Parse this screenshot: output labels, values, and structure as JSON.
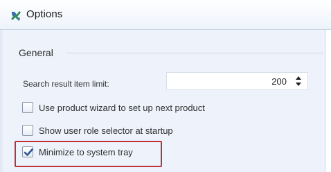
{
  "window": {
    "title": "Options"
  },
  "group": {
    "title": "General"
  },
  "search_limit": {
    "label": "Search result item limit:",
    "value": "200"
  },
  "checkboxes": [
    {
      "label": "Use product wizard to set up next product",
      "checked": false
    },
    {
      "label": "Show user role selector at startup",
      "checked": false
    },
    {
      "label": "Minimize to system tray",
      "checked": true
    }
  ],
  "colors": {
    "highlight": "#c0303a",
    "background": "#eef3fb"
  },
  "icons": {
    "app": "wrench-options-icon",
    "spinner": "spin-up-down-icon",
    "check": "check-mark-icon"
  }
}
